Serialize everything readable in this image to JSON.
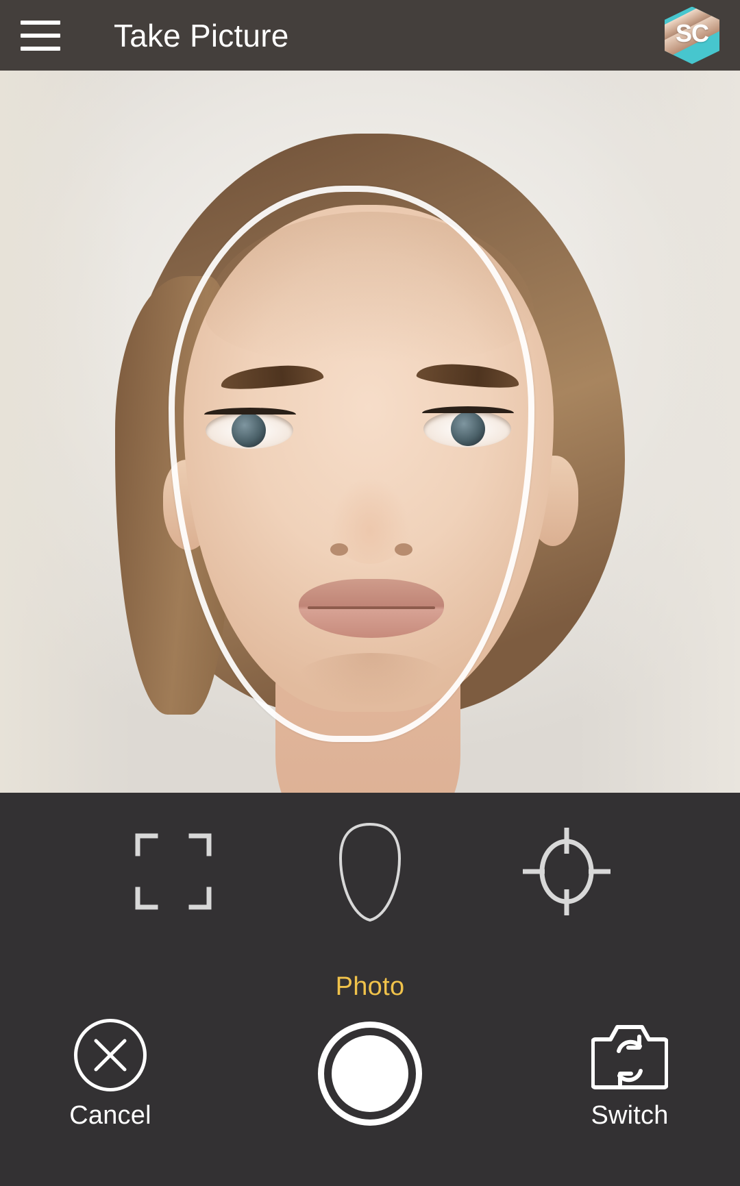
{
  "appbar": {
    "menu_icon": "hamburger-menu-icon",
    "title": "Take Picture",
    "logo_text": "SC",
    "logo_icon": "app-logo-icon",
    "bg_color": "#443F3C",
    "title_color": "#FFFFFF"
  },
  "preview": {
    "overlay_guide": "face-alignment-oval-guide",
    "subject": "portrait-of-woman-front-facing",
    "guide_color": "#FFFFFF"
  },
  "modes": {
    "items": [
      {
        "id": "frame",
        "icon": "crop-frame-icon",
        "label": ""
      },
      {
        "id": "face",
        "icon": "face-oval-icon",
        "label": ""
      },
      {
        "id": "target",
        "icon": "crosshair-target-icon",
        "label": ""
      }
    ],
    "selected_label": "Photo",
    "selected_label_color": "#F0C24B"
  },
  "actions": {
    "cancel": {
      "label": "Cancel",
      "icon": "close-x-circle-icon"
    },
    "shutter": {
      "label": "",
      "icon": "shutter-button-icon"
    },
    "switch": {
      "label": "Switch",
      "icon": "switch-camera-icon"
    },
    "label_color": "#FFFFFF"
  },
  "theme": {
    "panel_bg": "#333133",
    "appbar_bg": "#443F3C",
    "accent": "#F0C24B",
    "logo_teal": "#47C6CE"
  }
}
